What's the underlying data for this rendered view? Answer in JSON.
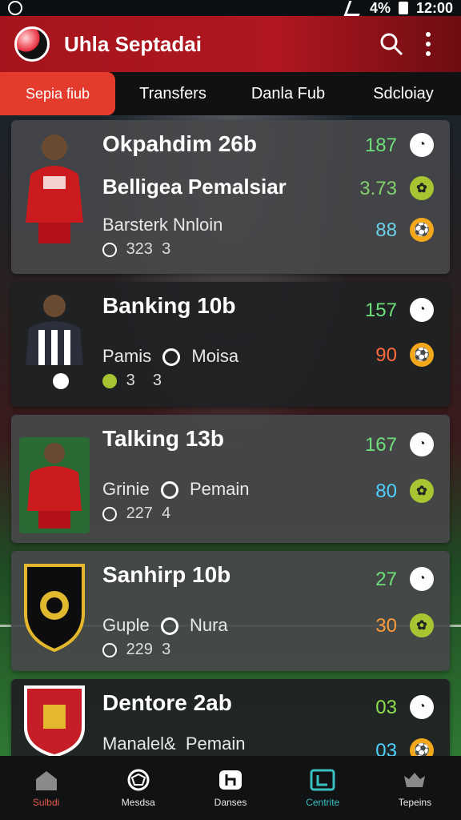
{
  "status": {
    "signal_text": "4%",
    "time": "12:00"
  },
  "app": {
    "title": "Uhla Septadai"
  },
  "tabs": [
    "Sepia fiub",
    "Transfers",
    "Danla Fub",
    "Sdcloiay"
  ],
  "cards": [
    {
      "title": "Okpahdim 26b",
      "title2": "Belligea Pemalsiar",
      "sub": "Barsterk Nnloin",
      "meta_a": "323",
      "meta_b": "3",
      "stats": [
        "187",
        "3.73",
        "88"
      ],
      "stat_colors": [
        "#6ee07a",
        "#82d06d",
        "#6ad1e6"
      ]
    },
    {
      "title": "Banking 10b",
      "sub_a": "Pamis",
      "sub_b": "Moisa",
      "meta_a": "3",
      "meta_b": "3",
      "stats": [
        "157",
        "90"
      ],
      "stat_colors": [
        "#6ee07a",
        "#ff6a3d"
      ]
    },
    {
      "title": "Talking 13b",
      "sub_a": "Grinie",
      "sub_b": "Pemain",
      "meta_a": "227",
      "meta_b": "4",
      "stats": [
        "167",
        "80"
      ],
      "stat_colors": [
        "#6ee07a",
        "#4fd0ff"
      ]
    },
    {
      "title": "Sanhirp 10b",
      "sub_a": "Guple",
      "sub_b": "Nura",
      "meta_a": "229",
      "meta_b": "3",
      "stats": [
        "27",
        "30"
      ],
      "stat_colors": [
        "#6ee07a",
        "#ff9a3a"
      ]
    },
    {
      "title": "Dentore 2ab",
      "sub_a": "Manalel&",
      "sub_b": "Pemain",
      "stats": [
        "03",
        "03"
      ],
      "stat_colors": [
        "#8ee050",
        "#4fd0ff"
      ]
    }
  ],
  "nav": [
    {
      "label": "Sulbdi"
    },
    {
      "label": "Mesdsa"
    },
    {
      "label": "Danses"
    },
    {
      "label": "Centrite"
    },
    {
      "label": "Tepeins"
    }
  ]
}
